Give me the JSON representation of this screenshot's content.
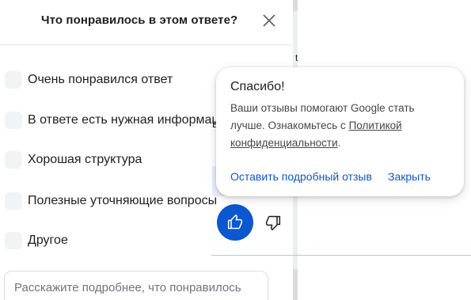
{
  "panel": {
    "title": "Что понравилось в этом ответе?",
    "options": [
      {
        "label": "Очень понравился ответ"
      },
      {
        "label": "В ответе есть нужная информация"
      },
      {
        "label": "Хорошая структура"
      },
      {
        "label": "Полезные уточняющие вопросы"
      },
      {
        "label": "Другое"
      }
    ],
    "details_placeholder": "Расскажите подробнее, что понравилось"
  },
  "background": {
    "fragment_1": "t",
    "fragment_2": "в"
  },
  "popup": {
    "title": "Спасибо!",
    "text_before_link": "Ваши отзывы помогают Google стать лучше. Ознакомьтесь с ",
    "link_text": "Политикой конфиденциальности",
    "text_after_link": ".",
    "leave_feedback_label": "Оставить подробный отзыв",
    "close_label": "Закрыть"
  },
  "icons": {
    "close": "close-icon",
    "thumb_up": "thumb-up-icon",
    "thumb_down": "thumb-down-icon"
  },
  "colors": {
    "accent": "#0b57d0",
    "checkbox": "#f1f3f4"
  }
}
